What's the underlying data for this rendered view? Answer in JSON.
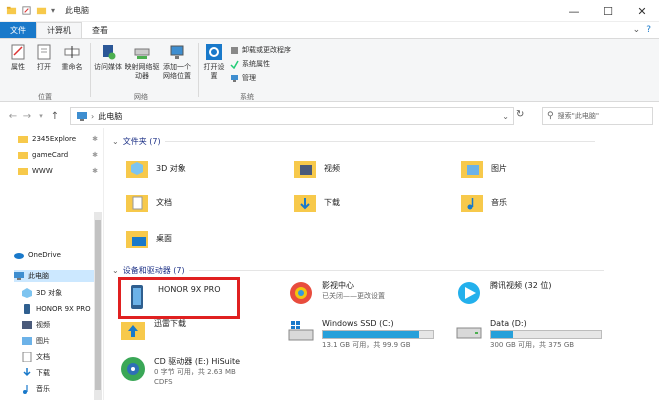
{
  "window": {
    "title": "此电脑",
    "controls": [
      "—",
      "☐",
      "✕"
    ]
  },
  "ribbon_tabs": {
    "file": "文件",
    "computer": "计算机",
    "view": "查看"
  },
  "ribbon": {
    "location_group": {
      "label": "位置",
      "buttons": [
        "属性",
        "打开",
        "重命名"
      ]
    },
    "network_group": {
      "label": "网络",
      "buttons": [
        "访问媒体",
        "映射网络驱动器",
        "添加一个网络位置"
      ]
    },
    "system_group": {
      "label": "系统",
      "open_settings": "打开设置",
      "small_items": [
        "卸载或更改程序",
        "系统属性",
        "管理"
      ]
    }
  },
  "address": {
    "path": "此电脑",
    "search_placeholder": "搜索\"此电脑\""
  },
  "sidebar": {
    "quick_items": [
      {
        "label": "2345Explore",
        "icon": "folder-icon",
        "pinned": true
      },
      {
        "label": "gameCard",
        "icon": "folder-icon",
        "pinned": true
      },
      {
        "label": "WWW",
        "icon": "folder-icon",
        "pinned": true
      }
    ],
    "onedrive": "OneDrive",
    "this_pc": "此电脑",
    "pc_items": [
      {
        "label": "3D 对象",
        "icon": "cube-icon"
      },
      {
        "label": "HONOR 9X PRO",
        "icon": "phone-icon"
      },
      {
        "label": "视频",
        "icon": "video-icon"
      },
      {
        "label": "图片",
        "icon": "picture-icon"
      },
      {
        "label": "文档",
        "icon": "document-icon"
      },
      {
        "label": "下载",
        "icon": "download-icon"
      },
      {
        "label": "音乐",
        "icon": "music-icon"
      }
    ]
  },
  "folders_section": {
    "title": "文件夹 (7)",
    "items": [
      {
        "label": "3D 对象",
        "icon": "cube-folder-icon"
      },
      {
        "label": "视频",
        "icon": "video-folder-icon"
      },
      {
        "label": "图片",
        "icon": "picture-folder-icon"
      },
      {
        "label": "文档",
        "icon": "document-folder-icon"
      },
      {
        "label": "下载",
        "icon": "download-folder-icon"
      },
      {
        "label": "音乐",
        "icon": "music-folder-icon"
      },
      {
        "label": "桌面",
        "icon": "desktop-folder-icon"
      }
    ]
  },
  "devices_section": {
    "title": "设备和驱动器 (7)",
    "items": [
      {
        "name": "HONOR 9X PRO",
        "icon": "phone-icon"
      },
      {
        "name": "影视中心",
        "sub": "已关闭——更改设置",
        "icon": "media-center-icon"
      },
      {
        "name": "腾讯视频 (32 位)",
        "icon": "tencent-video-icon"
      },
      {
        "name": "迅雷下载",
        "icon": "xunlei-icon"
      },
      {
        "name": "Windows SSD (C:)",
        "sub": "13.1 GB 可用，共 99.9 GB",
        "used_fraction": 0.87,
        "icon": "windows-drive-icon"
      },
      {
        "name": "Data (D:)",
        "sub": "300 GB 可用，共 375 GB",
        "used_fraction": 0.2,
        "icon": "drive-icon"
      },
      {
        "name": "CD 驱动器 (E:) HiSuite",
        "sub": "0 字节 可用，共 2.63 MB",
        "sub2": "CDFS",
        "icon": "hisuite-cd-icon"
      }
    ]
  },
  "colors": {
    "accent": "#1979ca",
    "folder": "#f7c94b",
    "highlight_box": "#e02020",
    "drive_bar": "#26a0da"
  }
}
